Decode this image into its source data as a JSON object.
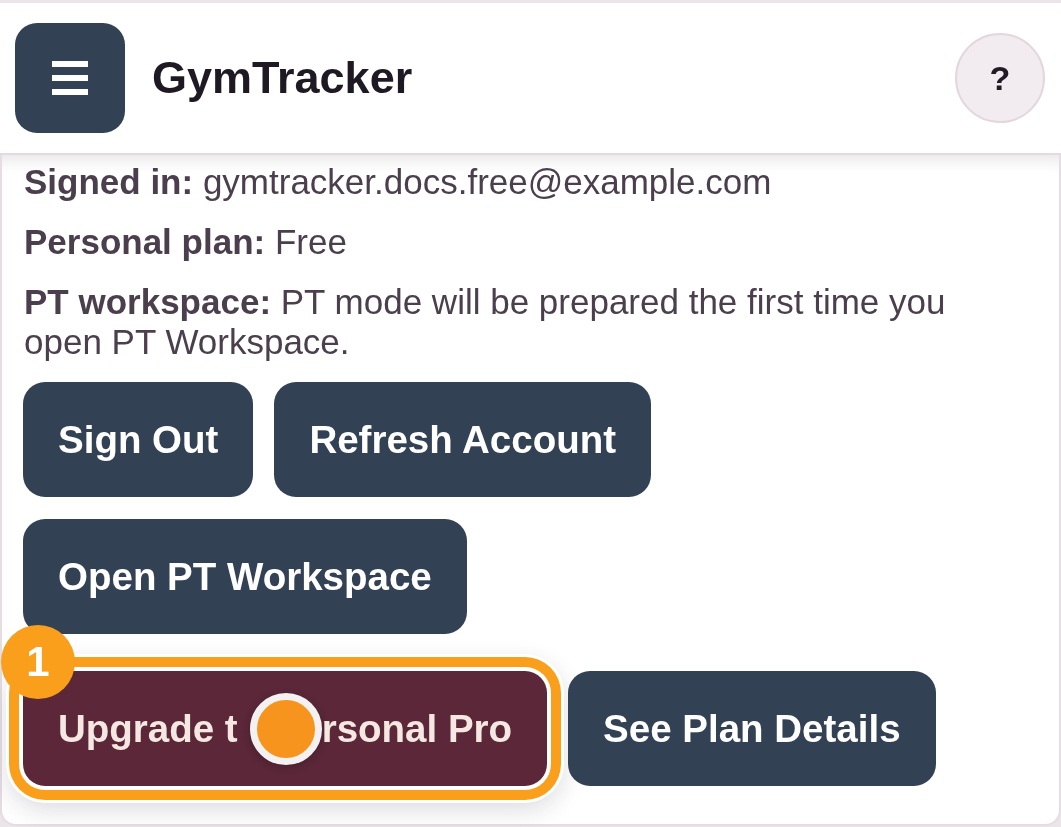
{
  "header": {
    "title": "GymTracker",
    "help": "?"
  },
  "account_info": [
    "**Signed in:** gymtracker.docs.free@example.com",
    "**Personal plan:** Free",
    "**PT workspace:** PT mode will be prepared the first time you open PT Workspace."
  ],
  "button_rows": [
    {
      "buttons": [
        {
          "label": "Sign Out",
          "kind": "default",
          "highlighted": false,
          "tapped": false
        },
        {
          "label": "Refresh Account",
          "kind": "default",
          "highlighted": false,
          "tapped": false
        }
      ]
    },
    {
      "buttons": [
        {
          "label": "Open PT Workspace",
          "kind": "default",
          "highlighted": false,
          "tapped": false
        }
      ]
    },
    {
      "buttons": [
        {
          "label_parts": [
            "Upgrade t",
            "rsonal Pro"
          ],
          "kind": "upgrade",
          "highlighted": true,
          "tapped": true,
          "tour_step": "1"
        },
        {
          "label": "See Plan Details",
          "kind": "default",
          "highlighted": false,
          "tapped": false
        }
      ]
    }
  ]
}
